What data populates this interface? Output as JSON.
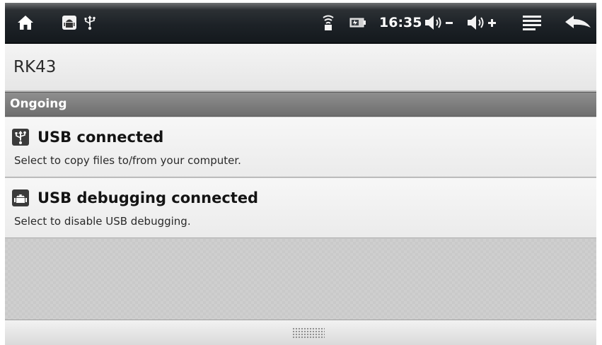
{
  "status_bar": {
    "left_icons": [
      "home-icon",
      "android-debug-icon",
      "usb-icon"
    ],
    "right_icons": [
      "wifi-icon",
      "battery-icon",
      "volume-down-icon",
      "volume-up-icon",
      "menu-icon",
      "back-icon"
    ],
    "time": "16:35",
    "background": "#1d2227"
  },
  "window": {
    "title": "RK43"
  },
  "section": {
    "label": "Ongoing"
  },
  "notifications": [
    {
      "icon": "usb-icon",
      "title": "USB connected",
      "description": "Select to copy files to/from your computer."
    },
    {
      "icon": "android-debug-icon",
      "title": "USB debugging connected",
      "description": "Select to disable USB debugging."
    }
  ],
  "handle": {
    "icon": "drag-handle-icon"
  }
}
